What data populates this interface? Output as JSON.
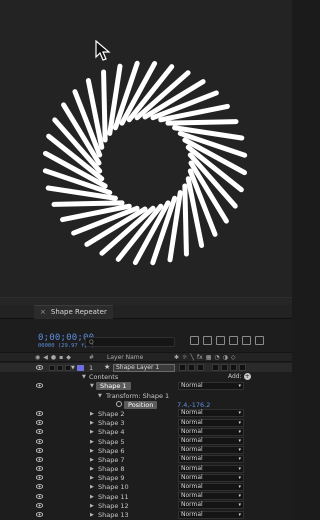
{
  "panel": {
    "tab_close": "×",
    "tab_title": "Shape Repeater"
  },
  "time": {
    "timecode": "0;00;00;00",
    "framecode": "00000 (29.97 fps)"
  },
  "search": {
    "icon": "search-icon",
    "placeholder": "Q"
  },
  "columns": {
    "hash": "#",
    "layer_name": "Layer Name"
  },
  "layer": {
    "number": "1",
    "star": "★",
    "name": "Shape Layer 1",
    "mode": "Normal"
  },
  "contents": {
    "label": "Contents",
    "add_label": "Add:",
    "add_button": "+"
  },
  "shape1": {
    "label": "Shape 1",
    "mode": "Normal"
  },
  "transform": {
    "label": "Transform: Shape 1"
  },
  "position": {
    "label": "Position",
    "value": "7.4,-176.2"
  },
  "shapes": [
    {
      "label": "Shape 2",
      "mode": "Normal"
    },
    {
      "label": "Shape 3",
      "mode": "Normal"
    },
    {
      "label": "Shape 4",
      "mode": "Normal"
    },
    {
      "label": "Shape 5",
      "mode": "Normal"
    },
    {
      "label": "Shape 6",
      "mode": "Normal"
    },
    {
      "label": "Shape 7",
      "mode": "Normal"
    },
    {
      "label": "Shape 8",
      "mode": "Normal"
    },
    {
      "label": "Shape 9",
      "mode": "Normal"
    },
    {
      "label": "Shape 10",
      "mode": "Normal"
    },
    {
      "label": "Shape 11",
      "mode": "Normal"
    },
    {
      "label": "Shape 12",
      "mode": "Normal"
    },
    {
      "label": "Shape 13",
      "mode": "Normal"
    }
  ],
  "colors": {
    "accent": "#5d8fe0",
    "label_color": "#6e6ee0",
    "shape_fill": "#ffffff",
    "canvas": "#232323"
  },
  "canvas": {
    "spiral_count": 36
  }
}
